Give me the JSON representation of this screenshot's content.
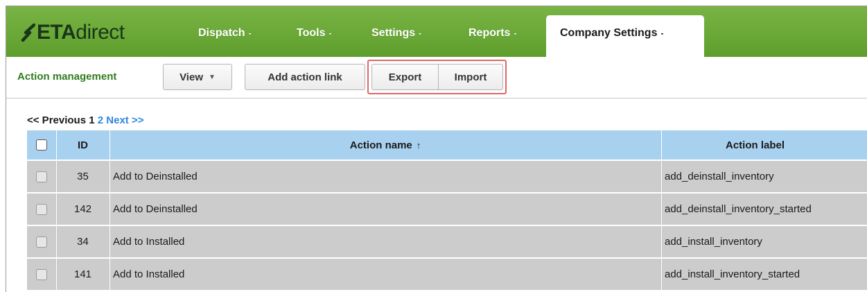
{
  "brand": {
    "bold": "ETA",
    "regular": "direct",
    "mark_color": "#19361a"
  },
  "nav": {
    "items": [
      {
        "label": "Dispatch",
        "caret": "-"
      },
      {
        "label": "Tools",
        "caret": "-"
      },
      {
        "label": "Settings",
        "caret": "-"
      },
      {
        "label": "Reports",
        "caret": "-"
      }
    ],
    "active": {
      "label": "Company Settings",
      "caret": "-"
    }
  },
  "toolbar": {
    "section_title": "Action management",
    "view_label": "View",
    "add_link_label": "Add action link",
    "export_label": "Export",
    "import_label": "Import"
  },
  "pager": {
    "prev": "<< Previous",
    "current": "1",
    "page2": "2",
    "next": "Next >>"
  },
  "table": {
    "headers": {
      "id": "ID",
      "name": "Action name",
      "label": "Action label",
      "sort_glyph": "↑"
    },
    "rows": [
      {
        "id": "35",
        "name": "Add to Deinstalled",
        "label": "add_deinstall_inventory"
      },
      {
        "id": "142",
        "name": "Add to Deinstalled",
        "label": "add_deinstall_inventory_started"
      },
      {
        "id": "34",
        "name": "Add to Installed",
        "label": "add_install_inventory"
      },
      {
        "id": "141",
        "name": "Add to Installed",
        "label": "add_install_inventory_started"
      }
    ]
  },
  "colors": {
    "nav_green": "#6aa836",
    "section_green": "#2f7d1e",
    "header_blue": "#a8d1f0",
    "row_gray": "#cccccc",
    "highlight_red": "#e06666",
    "link_blue": "#2e86de"
  }
}
